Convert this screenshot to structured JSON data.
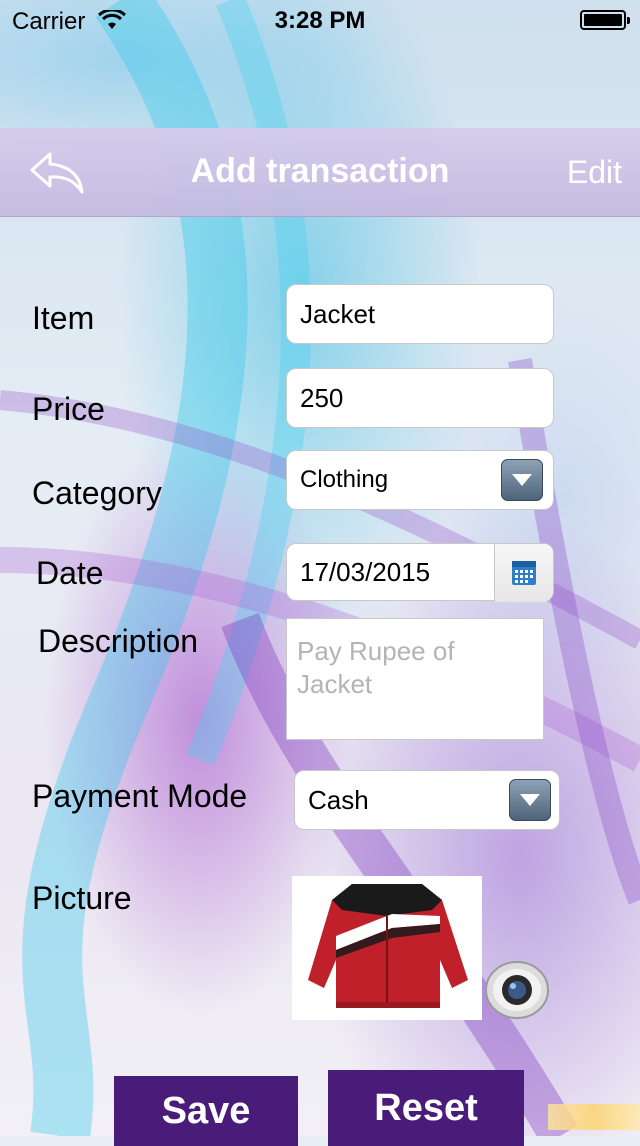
{
  "status_bar": {
    "carrier": "Carrier",
    "time": "3:28 PM"
  },
  "nav": {
    "title": "Add transaction",
    "edit": "Edit",
    "back_icon": "back-arrow-icon"
  },
  "form": {
    "item": {
      "label": "Item",
      "value": "Jacket"
    },
    "price": {
      "label": "Price",
      "value": "250"
    },
    "category": {
      "label": "Category",
      "value": "Clothing"
    },
    "date": {
      "label": "Date",
      "value": "17/03/2015"
    },
    "description": {
      "label": "Description",
      "placeholder": "Pay Rupee of Jacket"
    },
    "payment_mode": {
      "label": "Payment Mode",
      "value": "Cash"
    },
    "picture": {
      "label": "Picture"
    }
  },
  "buttons": {
    "save": "Save",
    "reset": "Reset"
  },
  "colors": {
    "button_bg": "#4a1c7a",
    "nav_bg": "#d2c8ea",
    "jacket_red": "#c0202a"
  }
}
